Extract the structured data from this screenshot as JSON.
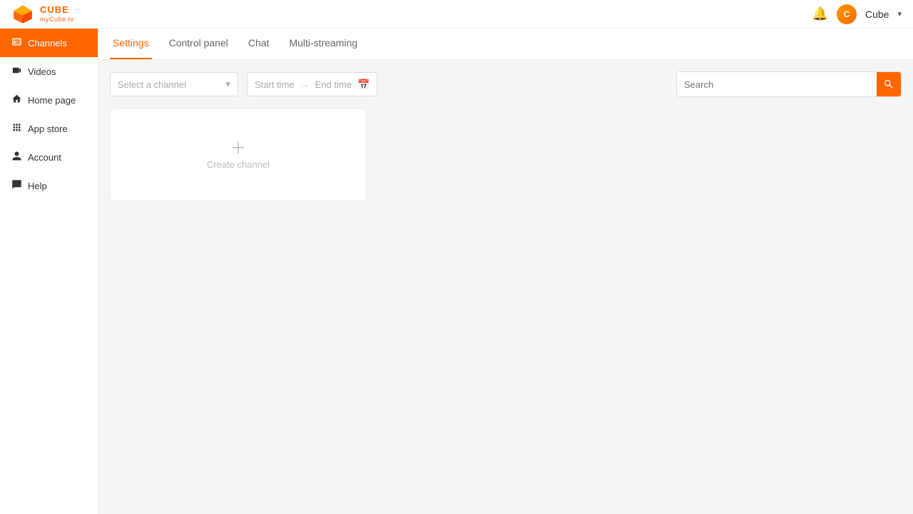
{
  "header": {
    "logo_text": "CUBE",
    "logo_sub": "myCube.tv",
    "user_name": "Cube",
    "user_initial": "C"
  },
  "sidebar": {
    "items": [
      {
        "id": "channels",
        "label": "Channels",
        "icon": "📺",
        "active": true
      },
      {
        "id": "videos",
        "label": "Videos",
        "icon": "🎬",
        "active": false
      },
      {
        "id": "homepage",
        "label": "Home page",
        "icon": "🏠",
        "active": false
      },
      {
        "id": "appstore",
        "label": "App store",
        "icon": "🔲",
        "active": false
      },
      {
        "id": "account",
        "label": "Account",
        "icon": "👤",
        "active": false
      },
      {
        "id": "help",
        "label": "Help",
        "icon": "💬",
        "active": false
      }
    ]
  },
  "tabs": {
    "items": [
      {
        "id": "settings",
        "label": "Settings",
        "active": true
      },
      {
        "id": "control-panel",
        "label": "Control panel",
        "active": false
      },
      {
        "id": "chat",
        "label": "Chat",
        "active": false
      },
      {
        "id": "multi-streaming",
        "label": "Multi-streaming",
        "active": false
      }
    ]
  },
  "toolbar": {
    "select_placeholder": "Select a channel",
    "start_time_placeholder": "Start time",
    "end_time_placeholder": "End time",
    "search_placeholder": "Search"
  },
  "create_channel": {
    "label": "Create channel"
  },
  "colors": {
    "accent": "#ff6600"
  }
}
